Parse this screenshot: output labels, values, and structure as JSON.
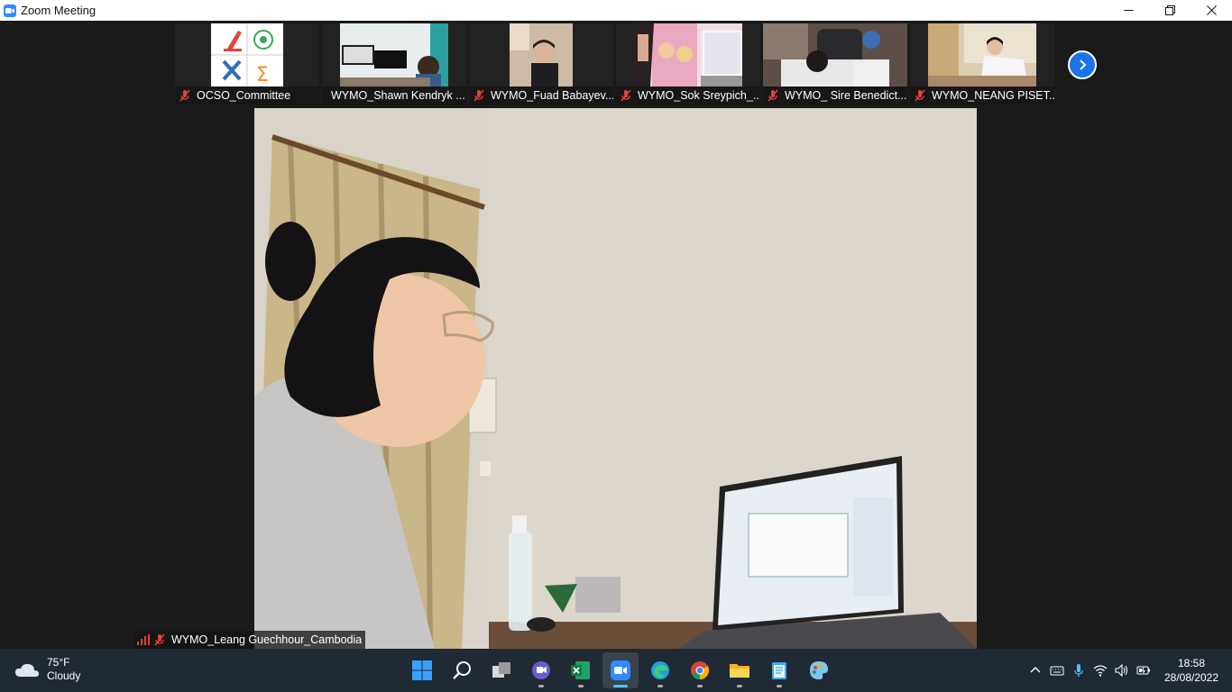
{
  "window": {
    "title": "Zoom Meeting",
    "controls": [
      "minimize",
      "restore",
      "close"
    ]
  },
  "participants": [
    {
      "name": "OCSO_Committee",
      "muted": true
    },
    {
      "name": "WYMO_Shawn Kendryk ...",
      "muted": false
    },
    {
      "name": "WYMO_Fuad Babayev...",
      "muted": true
    },
    {
      "name": "WYMO_Sok Sreypich_...",
      "muted": true
    },
    {
      "name": "WYMO_ Sire Benedict...",
      "muted": true
    },
    {
      "name": "WYMO_NEANG PISET...",
      "muted": true
    }
  ],
  "active_speaker": {
    "name": "WYMO_Leang Guechhour_Cambodia",
    "muted": true
  },
  "taskbar": {
    "weather": {
      "temp": "75°F",
      "condition": "Cloudy"
    },
    "apps": [
      {
        "name": "start",
        "active": false
      },
      {
        "name": "search",
        "active": false
      },
      {
        "name": "task-view",
        "active": false
      },
      {
        "name": "teams-chat",
        "active": false
      },
      {
        "name": "excel",
        "active": false
      },
      {
        "name": "zoom",
        "active": true
      },
      {
        "name": "edge",
        "active": false
      },
      {
        "name": "chrome",
        "active": false
      },
      {
        "name": "file-explorer",
        "active": false
      },
      {
        "name": "notepad",
        "active": false
      },
      {
        "name": "paint",
        "active": false
      }
    ],
    "clock": {
      "time": "18:58",
      "date": "28/08/2022"
    }
  },
  "colors": {
    "zoom_blue": "#2d8cff",
    "muted_red": "#e0443a",
    "taskbar": "#1f2a35"
  }
}
